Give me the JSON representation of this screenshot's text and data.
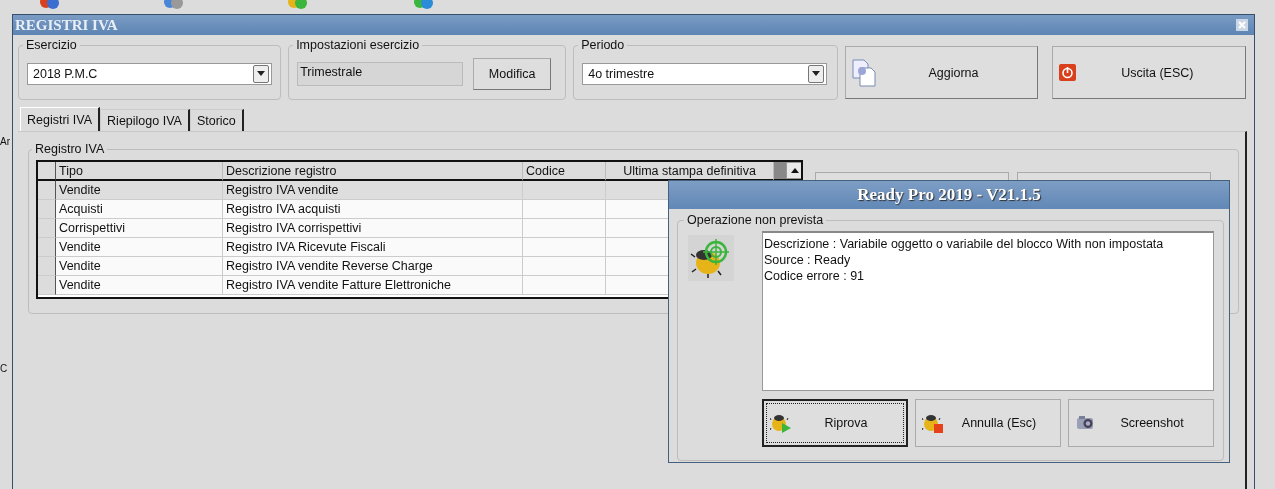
{
  "background_labels": [
    "Ar",
    "C"
  ],
  "window": {
    "title": "REGISTRI IVA"
  },
  "esercizio": {
    "label": "Esercizio",
    "value": "2018 P.M.C"
  },
  "impostazioni": {
    "label": "Impostazioni esercizio",
    "value": "Trimestrale",
    "button": "Modifica"
  },
  "periodo": {
    "label": "Periodo",
    "value": "4o trimestre"
  },
  "actions": [
    {
      "label": "Aggiorna",
      "kind": "refresh"
    },
    {
      "label": "Uscita (ESC)",
      "kind": "exit"
    }
  ],
  "tabs": [
    {
      "label": "Registri IVA",
      "selected": true
    },
    {
      "label": "Riepilogo IVA",
      "selected": false
    },
    {
      "label": "Storico",
      "selected": false
    }
  ],
  "registro": {
    "title": "Registro IVA",
    "columns": [
      "Tipo",
      "Descrizione registro",
      "Codice",
      "Ultima stampa definitiva"
    ],
    "rows": [
      {
        "cells": [
          "Vendite",
          "Registro IVA vendite"
        ],
        "selected": true
      },
      {
        "cells": [
          "Acquisti",
          "Registro IVA acquisti"
        ],
        "selected": false
      },
      {
        "cells": [
          "Corrispettivi",
          "Registro IVA corrispettivi"
        ],
        "selected": false
      },
      {
        "cells": [
          "Vendite",
          "Registro IVA Ricevute Fiscali"
        ],
        "selected": false
      },
      {
        "cells": [
          "Vendite",
          "Registro IVA vendite Reverse Charge"
        ],
        "selected": false
      },
      {
        "cells": [
          "Vendite",
          "Registro IVA vendite Fatture Elettroniche"
        ],
        "selected": false
      }
    ]
  },
  "dialog": {
    "title": "Ready Pro 2019 - V21.1.5",
    "group": "Operazione non prevista",
    "message": [
      "Descrizione : Variabile oggetto o variabile del blocco With non impostata",
      "Source : Ready",
      "Codice errore : 91"
    ],
    "buttons": [
      {
        "label": "Riprova",
        "kind": "retry",
        "focused": true
      },
      {
        "label": "Annulla (Esc)",
        "kind": "cancel",
        "focused": false
      },
      {
        "label": "Screenshot",
        "kind": "camera",
        "focused": false
      }
    ]
  }
}
